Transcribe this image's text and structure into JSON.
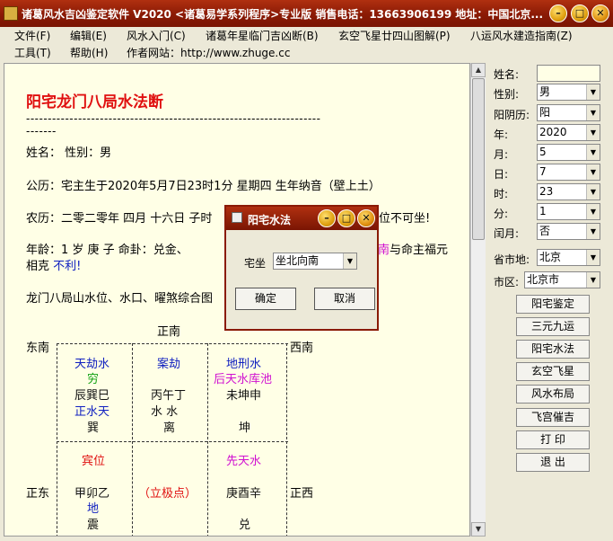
{
  "window": {
    "title": "诸葛风水吉凶鉴定软件 V2020 <诸葛易学系列程序>专业版    销售电话：13663906199    地址：中国北京..."
  },
  "menu": {
    "row1": [
      "文件(F)",
      "编辑(E)",
      "风水入门(C)",
      "诸葛年星临门吉凶断(B)",
      "玄空飞星廿四山图解(P)",
      "八运风水建造指南(Z)"
    ],
    "row2": [
      "工具(T)",
      "帮助(H)",
      "作者网站：http://www.zhuge.cc"
    ]
  },
  "doc": {
    "title": "阳宅龙门八局水法断",
    "dash1": "--------------------------------------------------------------------",
    "dash2": "-------",
    "name_line": "姓名：  性别：男",
    "solar_line": "公历：宅主生于2020年5月7日23时1分  星期四  生年纳音（壁上土）",
    "lunar_line": "农历：二零二零年  四月  十六日  子时",
    "lunar_tail": "位不可坐!",
    "age_line": "年龄：1 岁    庚 子    命卦：兑金、",
    "age_tail_south": "南",
    "age_tail": " 与命主福元",
    "age_line2_a": "相克 ",
    "age_line2_b": "不利!",
    "chart_intro": "龙门八局山水位、水口、曜煞综合图"
  },
  "grid": {
    "top_dir": "正南",
    "left_top_dir": "东南",
    "right_top_dir": "西南",
    "left_mid_dir": "正东",
    "right_mid_dir": "正西",
    "c1": {
      "a": "天劫水",
      "b": "穷",
      "c": "辰巽巳",
      "d": "正水天",
      "e": "巽"
    },
    "c2": {
      "a": "案劫",
      "c": "丙午丁",
      "d": "水  水",
      "e": "离"
    },
    "c3": {
      "a": "地刑水",
      "b": "后天水库池",
      "c": "未坤申",
      "e": "坤"
    },
    "c4": {
      "a": "宾位",
      "c": "甲卯乙",
      "d": "地",
      "e": "震"
    },
    "c5": {
      "a": "（立极点）"
    },
    "c6": {
      "a": "先天水",
      "c": "庚酉辛",
      "e": "兑"
    }
  },
  "panel": {
    "name_label": "姓名:",
    "name_value": "",
    "gender_label": "性别:",
    "gender_value": "男",
    "yinyang_label": "阳阴历:",
    "yinyang_value": "阳",
    "year_label": "年:",
    "year_value": "2020",
    "month_label": "月:",
    "month_value": "5",
    "day_label": "日:",
    "day_value": "7",
    "hour_label": "时:",
    "hour_value": "23",
    "minute_label": "分:",
    "minute_value": "1",
    "leap_label": "闰月:",
    "leap_value": "否",
    "province_label": "省市地:",
    "province_value": "北京",
    "district_label": "市区:",
    "district_value": "北京市",
    "buttons": [
      "阳宅鉴定",
      "三元九运",
      "阳宅水法",
      "玄空飞星",
      "风水布局",
      "飞宫催吉",
      "打 印",
      "退 出"
    ]
  },
  "dialog": {
    "title": "阳宅水法",
    "label": "宅坐",
    "select_value": "坐北向南",
    "ok": "确定",
    "cancel": "取消"
  }
}
